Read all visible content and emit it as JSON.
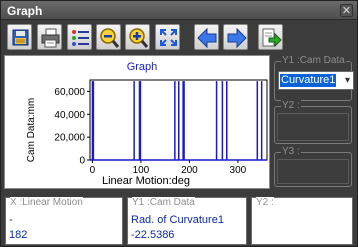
{
  "window": {
    "title": "Graph",
    "close_glyph": "✕"
  },
  "toolbar": {
    "buttons": [
      {
        "name": "save-button",
        "icon": "save-icon"
      },
      {
        "name": "print-button",
        "icon": "printer-icon"
      },
      {
        "name": "legend-button",
        "icon": "list-icon"
      },
      {
        "name": "zoom-out-button",
        "icon": "zoom-out-icon"
      },
      {
        "name": "zoom-in-button",
        "icon": "zoom-in-icon"
      },
      {
        "name": "fit-button",
        "icon": "fit-to-window-icon"
      },
      {
        "name": "back-button",
        "icon": "arrow-left-icon"
      },
      {
        "name": "forward-button",
        "icon": "arrow-right-icon"
      },
      {
        "name": "export-button",
        "icon": "export-icon"
      }
    ]
  },
  "side": {
    "y1_label": "Y1 :Cam Data",
    "y1_selected": "Curvature1",
    "y2_label": "Y2 :",
    "y3_label": "Y3 :"
  },
  "bottom": {
    "x_label": "X :Linear Motion",
    "x_line1": "-",
    "x_line2": "182",
    "y1_label": "Y1 :Cam Data",
    "y1_line1": "Rad. of Curvature1",
    "y1_line2": "-22.5386",
    "y2_label": "Y2 :"
  },
  "colors": {
    "series": "#1a1acc",
    "accent": "#0a64d8"
  },
  "chart_data": {
    "type": "line",
    "title": "Graph",
    "xlabel": "Linear Motion:deg",
    "ylabel": "Cam Data:mm",
    "xlim": [
      -5,
      360
    ],
    "ylim": [
      0,
      70000
    ],
    "xticks": [
      0,
      100,
      200,
      300
    ],
    "yticks": [
      0,
      20000,
      40000,
      60000
    ],
    "ytick_labels": [
      "0",
      "20,000",
      "40,000",
      "60,000"
    ],
    "spikes_x": [
      0,
      2,
      86,
      97,
      99,
      170,
      178,
      187,
      189,
      256,
      268,
      277,
      340,
      349
    ],
    "spike_value": 69000
  }
}
